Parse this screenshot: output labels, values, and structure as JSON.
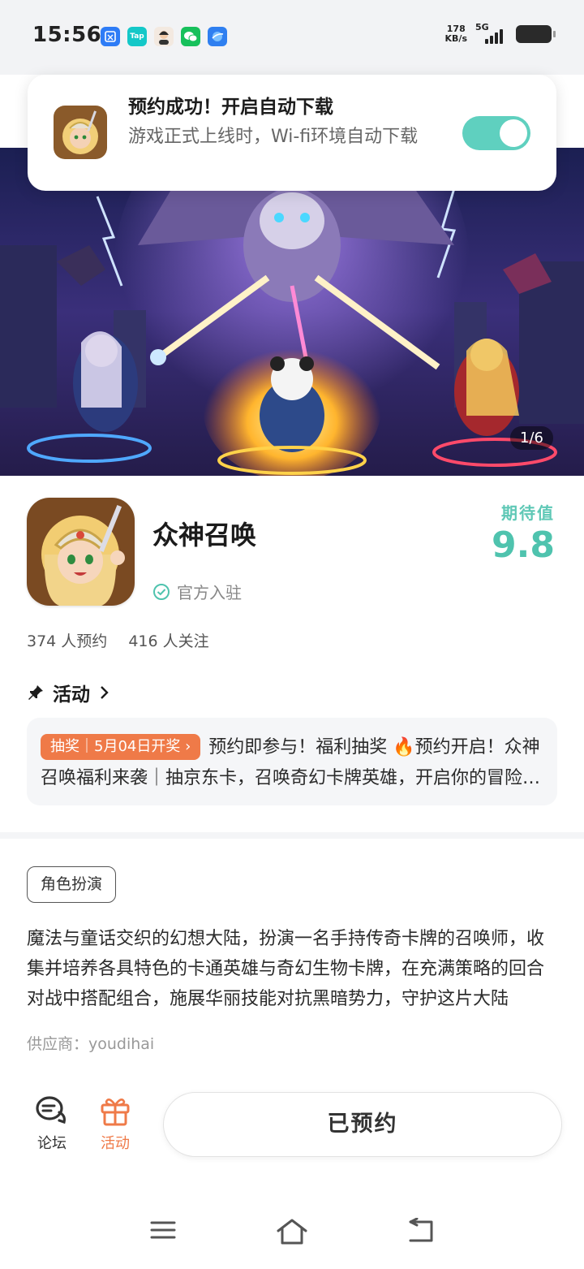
{
  "status_bar": {
    "time": "15:56",
    "app_icons": [
      "scissors-app-icon",
      "tap-app-icon",
      "avatar-app-icon",
      "wechat-icon",
      "browser-icon"
    ],
    "tap_label": "Tap",
    "speed_value": "178",
    "speed_unit": "KB/s",
    "network": "5G"
  },
  "toast": {
    "title": "预约成功！开启自动下载",
    "description": "游戏正式上线时，Wi-fi环境自动下载",
    "toggle_on": true,
    "toggle_color": "#5fd0bf"
  },
  "banner": {
    "counter": "1/6"
  },
  "app": {
    "name": "众神召唤",
    "official_label": "官方入驻",
    "expect_label": "期待值",
    "expect_score": "9.8",
    "reservations": "374 人预约",
    "followers": "416 人关注"
  },
  "activity": {
    "heading": "活动",
    "badge": "抽奖｜5月04日开奖 ›",
    "text": "预约即参与！福利抽奖 🔥预约开启！众神召唤福利来袭｜抽京东卡，召唤奇幻卡牌英雄，开启你的冒险之旅"
  },
  "details": {
    "tag": "角色扮演",
    "description": "魔法与童话交织的幻想大陆，扮演一名手持传奇卡牌的召唤师，收集并培养各具特色的卡通英雄与奇幻生物卡牌，在充满策略的回合对战中搭配组合，施展华丽技能对抗黑暗势力，守护这片大陆",
    "vendor": "供应商：youdihai"
  },
  "bottom_bar": {
    "forum_label": "论坛",
    "activity_label": "活动",
    "reserve_button": "已预约"
  },
  "colors": {
    "accent_teal": "#4fc3ae",
    "accent_orange": "#ef7a48"
  }
}
